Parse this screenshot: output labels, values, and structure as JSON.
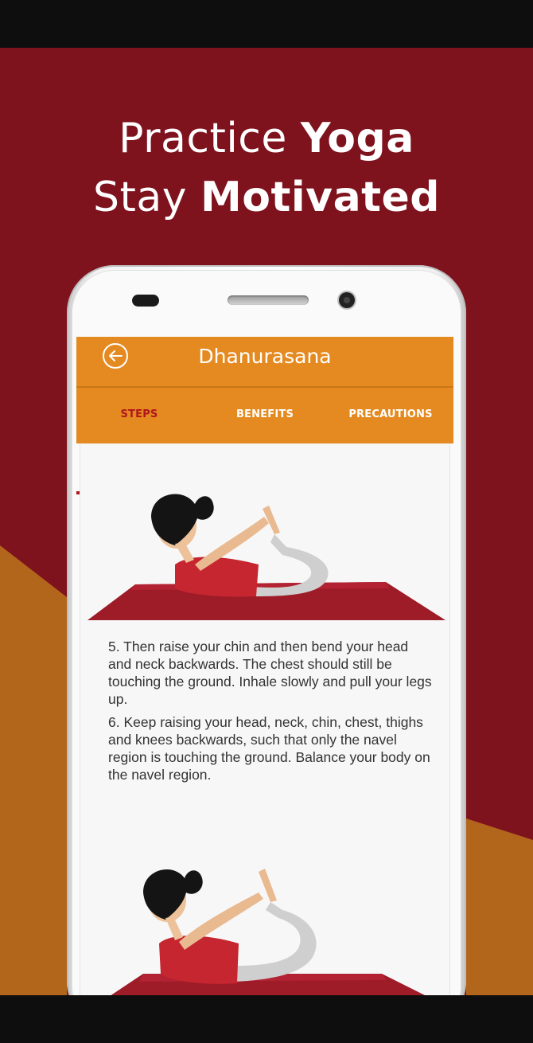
{
  "promo": {
    "line1_light": "Practice ",
    "line1_bold": "Yoga",
    "line2_light": "Stay ",
    "line2_bold": "Motivated",
    "colors": {
      "background": "#7e121d",
      "accent": "#b1661b"
    }
  },
  "app": {
    "title": "Dhanurasana",
    "back_icon": "back-arrow-circle-icon",
    "colors": {
      "appbar": "#e48a20",
      "active_tab": "#b0161d"
    }
  },
  "tabs": [
    {
      "label": "STEPS",
      "active": true
    },
    {
      "label": "BENEFITS",
      "active": false
    },
    {
      "label": "PRECAUTIONS",
      "active": false
    }
  ],
  "steps": [
    "5. Then raise your chin and then bend your head and neck backwards. The chest should still be touching the ground. Inhale slowly and pull your legs up.",
    "6. Keep raising your head, neck, chin, chest, thighs and knees backwards, such that only the navel region is touching the ground. Balance your body on the navel region."
  ]
}
